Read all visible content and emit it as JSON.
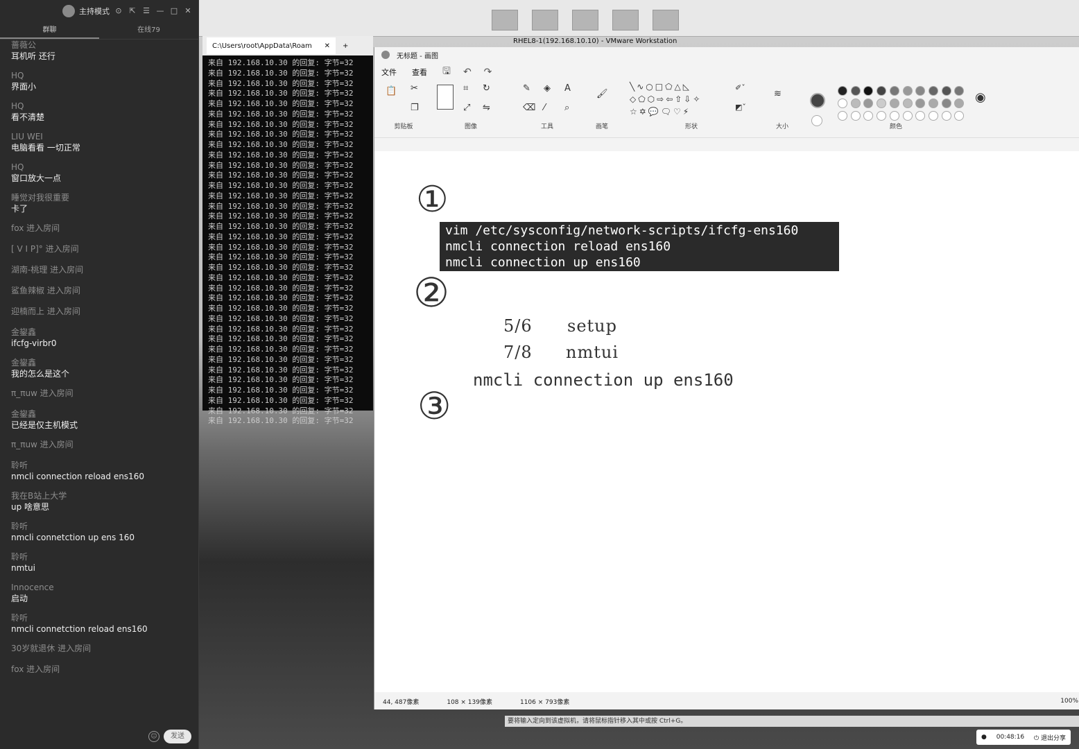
{
  "chat": {
    "mode_label": "主持模式",
    "tabs": [
      "群聊",
      "在线79"
    ],
    "messages": [
      {
        "user": "蔷薇公",
        "text": "耳机听 还行"
      },
      {
        "user": "HQ",
        "text": "界面小"
      },
      {
        "user": "HQ",
        "text": "看不清楚"
      },
      {
        "user": "LIU WEI",
        "text": "电脑看看 一切正常"
      },
      {
        "user": "HQ",
        "text": "窗口放大一点"
      },
      {
        "user": "睡觉对我很重要",
        "text": "卡了"
      }
    ],
    "system1": [
      "fox 进入房间",
      "[  V  I  P]° 进入房间",
      "湖南-桃理 进入房间",
      "鲨鱼辣椒 进入房间",
      "迎楠而上 进入房间"
    ],
    "messages2": [
      {
        "user": "金鋆鑫",
        "text": "ifcfg-virbr0"
      },
      {
        "user": "金鋆鑫",
        "text": "我的怎么是这个"
      }
    ],
    "system2": "π_πuw 进入房间",
    "messages3": [
      {
        "user": "金鋆鑫",
        "text": "已经是仅主机模式"
      }
    ],
    "system3": "π_πuw 进入房间",
    "messages4": [
      {
        "user": "聆听",
        "text": "nmcli connection reload ens160"
      },
      {
        "user": "我在B站上大学",
        "text": "up 啥意思"
      },
      {
        "user": "聆听",
        "text": "nmcli connetction up ens 160"
      },
      {
        "user": "聆听",
        "text": "nmtui"
      },
      {
        "user": "Innocence",
        "text": "启动"
      },
      {
        "user": "聆听",
        "text": "nmcli connetction reload ens160"
      }
    ],
    "system4": [
      "30岁就退休 进入房间",
      "fox 进入房间"
    ],
    "send_label": "发送"
  },
  "terminal": {
    "tab_title": "C:\\Users\\root\\AppData\\Roam",
    "line": "来自 192.168.10.30 的回复: 字节=32",
    "line_count": 36
  },
  "vmware": {
    "title": "RHEL8-1(192.168.10.10) - VMware Workstation",
    "hint": "要将输入定向到该虚拟机，请将鼠标指针移入其中或按 Ctrl+G。"
  },
  "paint": {
    "title": "无标题 - 画图",
    "menu": [
      "文件",
      "查看"
    ],
    "groups": [
      "剪贴板",
      "图像",
      "工具",
      "画笔",
      "形状",
      "大小",
      "颜色"
    ],
    "commands": [
      "vim /etc/sysconfig/network-scripts/ifcfg-ens160",
      "nmcli connection reload ens160",
      "nmcli connection up ens160"
    ],
    "hand_numbers": [
      "①",
      "②",
      "③"
    ],
    "notes": [
      {
        "key": "5/6",
        "value": "setup"
      },
      {
        "key": "7/8",
        "value": "nmtui"
      }
    ],
    "note3": "nmcli connection up ens160",
    "status": {
      "cursor": "44, 487像素",
      "selection": "108 × 139像素",
      "canvas": "1106 × 793像素",
      "zoom": "100%"
    },
    "colors_row1": [
      "#222222",
      "#555555",
      "#111111",
      "#444444",
      "#777777",
      "#999999",
      "#888888",
      "#666666",
      "#555555",
      "#777777"
    ],
    "colors_row2": [
      "#ffffff",
      "#bbbbbb",
      "#999999",
      "#cccccc",
      "#aaaaaa",
      "#bbbbbb",
      "#999999",
      "#aaaaaa",
      "#888888",
      "#aaaaaa"
    ]
  },
  "share": {
    "timer": "00:48:16",
    "stop_label": "退出分享"
  }
}
